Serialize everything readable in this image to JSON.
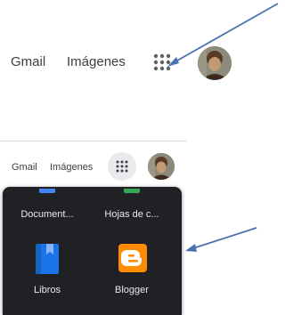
{
  "header_large": {
    "gmail_label": "Gmail",
    "images_label": "Imágenes"
  },
  "header_small": {
    "gmail_label": "Gmail",
    "images_label": "Imágenes"
  },
  "apps_panel": {
    "items": [
      {
        "label": "Document...",
        "icon": "docs-icon",
        "color": "#4285f4"
      },
      {
        "label": "Hojas de c...",
        "icon": "sheets-icon",
        "color": "#34a853"
      },
      {
        "label": "Libros",
        "icon": "books-icon",
        "color": "#1a73e8"
      },
      {
        "label": "Blogger",
        "icon": "blogger-icon",
        "color": "#ff8c00"
      }
    ]
  },
  "colors": {
    "panel_bg": "#202124",
    "arrow": "#4a72b0",
    "text": "#3c4043"
  }
}
